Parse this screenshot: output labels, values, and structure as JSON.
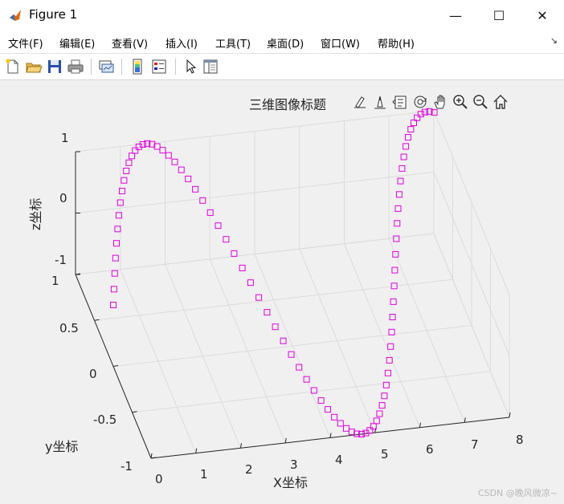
{
  "window": {
    "title": "Figure 1",
    "minimize_glyph": "—",
    "maximize_glyph": "☐",
    "close_glyph": "✕"
  },
  "menu": [
    {
      "label": "文件(F)"
    },
    {
      "label": "编辑(E)"
    },
    {
      "label": "查看(V)"
    },
    {
      "label": "插入(I)"
    },
    {
      "label": "工具(T)"
    },
    {
      "label": "桌面(D)"
    },
    {
      "label": "窗口(W)"
    },
    {
      "label": "帮助(H)"
    }
  ],
  "menu_corner": "↘",
  "toolbar": [
    "new-figure-icon",
    "open-file-icon",
    "save-icon",
    "print-icon",
    "link-plot-icon",
    "colorbar-icon",
    "legend-icon",
    "pointer-icon",
    "property-inspector-icon"
  ],
  "axes_toolbar": [
    "brush-icon",
    "data-tip-icon",
    "rotate-icon",
    "pan-icon",
    "zoom-in-icon",
    "zoom-out-icon",
    "home-icon"
  ],
  "chart_data": {
    "type": "scatter",
    "dimensions": 3,
    "title": "三维图像标题",
    "xlabel": "X坐标",
    "ylabel": "y坐标",
    "zlabel": "z坐标",
    "xlim": [
      0,
      8
    ],
    "ylim": [
      -1,
      1
    ],
    "zlim": [
      -1,
      1
    ],
    "x_ticks": [
      "0",
      "1",
      "2",
      "3",
      "4",
      "5",
      "6",
      "7",
      "8"
    ],
    "y_ticks": [
      "-1",
      "-0.5",
      "0",
      "0.5",
      "1"
    ],
    "z_ticks": [
      "-1",
      "0",
      "1"
    ],
    "grid": true,
    "box": false,
    "marker": "square",
    "color": "#e000e0",
    "view": {
      "azimuth": -12,
      "elevation": 30
    },
    "series": [
      {
        "x": [
          0,
          0.1,
          0.2,
          0.3,
          0.4,
          0.5,
          0.6,
          0.7,
          0.8,
          0.9,
          1,
          1.1,
          1.2,
          1.3,
          1.4,
          1.5,
          1.6,
          1.7,
          1.8,
          1.9,
          2,
          2.1,
          2.2,
          2.3,
          2.4,
          2.5,
          2.6,
          2.7,
          2.8,
          2.9,
          3,
          3.1,
          3.2,
          3.3,
          3.4,
          3.5,
          3.6,
          3.7,
          3.8,
          3.9,
          4,
          4.1,
          4.2,
          4.3,
          4.4,
          4.5,
          4.6,
          4.7,
          4.8,
          4.9,
          5,
          5.1,
          5.2,
          5.3,
          5.4,
          5.5,
          5.6,
          5.7,
          5.8,
          5.9,
          6,
          6.1,
          6.2,
          6.3,
          6.4,
          6.5,
          6.6,
          6.7,
          6.8,
          6.9,
          7,
          7.1,
          7.2,
          7.3,
          7.4,
          7.5,
          7.6,
          7.7,
          7.8,
          7.9,
          8
        ],
        "y": [
          0,
          0.1,
          0.199,
          0.296,
          0.389,
          0.479,
          0.565,
          0.644,
          0.717,
          0.783,
          0.841,
          0.891,
          0.932,
          0.964,
          0.985,
          0.997,
          1,
          0.992,
          0.974,
          0.946,
          0.909,
          0.863,
          0.808,
          0.746,
          0.675,
          0.598,
          0.516,
          0.427,
          0.335,
          0.239,
          0.141,
          0.042,
          -0.058,
          -0.158,
          -0.256,
          -0.351,
          -0.443,
          -0.53,
          -0.612,
          -0.688,
          -0.757,
          -0.818,
          -0.872,
          -0.916,
          -0.952,
          -0.978,
          -0.994,
          -1,
          -0.996,
          -0.982,
          -0.959,
          -0.926,
          -0.883,
          -0.832,
          -0.773,
          -0.706,
          -0.631,
          -0.551,
          -0.465,
          -0.374,
          -0.279,
          -0.182,
          -0.083,
          0.017,
          0.117,
          0.215,
          0.312,
          0.405,
          0.494,
          0.578,
          0.657,
          0.729,
          0.794,
          0.85,
          0.899,
          0.938,
          0.968,
          0.988,
          0.998,
          0.999,
          0.989
        ],
        "z": [
          0,
          0.1,
          0.199,
          0.296,
          0.389,
          0.479,
          0.565,
          0.644,
          0.717,
          0.783,
          0.841,
          0.891,
          0.932,
          0.964,
          0.985,
          0.997,
          1,
          0.992,
          0.974,
          0.946,
          0.909,
          0.863,
          0.808,
          0.746,
          0.675,
          0.598,
          0.516,
          0.427,
          0.335,
          0.239,
          0.141,
          0.042,
          -0.058,
          -0.158,
          -0.256,
          -0.351,
          -0.443,
          -0.53,
          -0.612,
          -0.688,
          -0.757,
          -0.818,
          -0.872,
          -0.916,
          -0.952,
          -0.978,
          -0.994,
          -1,
          -0.996,
          -0.982,
          -0.959,
          -0.926,
          -0.883,
          -0.832,
          -0.773,
          -0.706,
          -0.631,
          -0.551,
          -0.465,
          -0.374,
          -0.279,
          -0.182,
          -0.083,
          0.017,
          0.117,
          0.215,
          0.312,
          0.405,
          0.494,
          0.578,
          0.657,
          0.729,
          0.794,
          0.85,
          0.899,
          0.938,
          0.968,
          0.988,
          0.998,
          0.999,
          0.989
        ]
      }
    ]
  },
  "watermark": "CSDN @晚风微凉~"
}
